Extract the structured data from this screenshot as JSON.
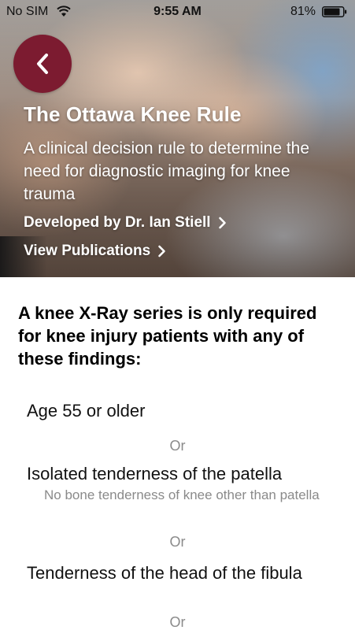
{
  "status_bar": {
    "carrier": "No SIM",
    "time": "9:55 AM",
    "battery": "81%"
  },
  "colors": {
    "accent": "#7c1b30",
    "muted_text": "#8a8a8a"
  },
  "hero": {
    "title": "The Ottawa Knee Rule",
    "subtitle": "A clinical decision rule to determine the need for diagnostic imaging for knee trauma",
    "developer_link": "Developed by Dr. Ian Stiell",
    "publications_link": "View Publications"
  },
  "content": {
    "intro": "A knee X-Ray series is only required for knee injury patients with any of these findings:",
    "separator_label": "Or",
    "findings": [
      {
        "title": "Age 55 or older",
        "note": ""
      },
      {
        "title": "Isolated tenderness of the patella",
        "note": "No bone tenderness of knee other than patella"
      },
      {
        "title": "Tenderness of the head of the fibula",
        "note": ""
      }
    ]
  }
}
